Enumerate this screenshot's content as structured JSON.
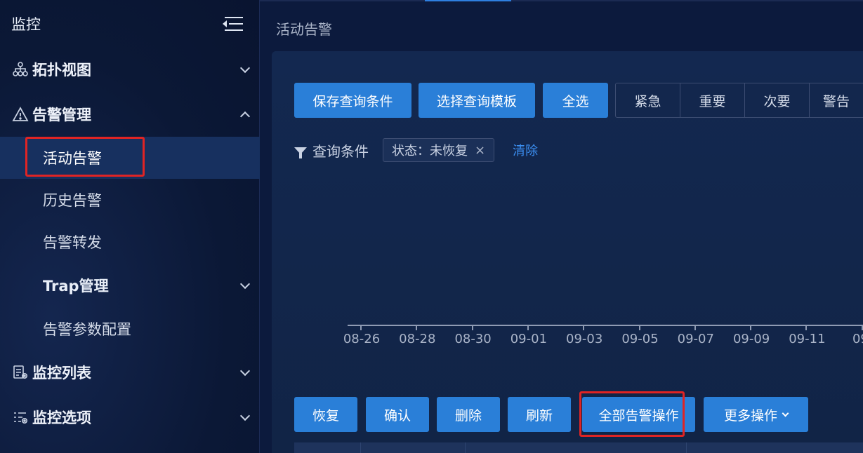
{
  "sidebar": {
    "title": "监控",
    "groups": [
      {
        "label": "拓扑视图",
        "icon": "topology-icon",
        "expanded": false
      },
      {
        "label": "告警管理",
        "icon": "warning-icon",
        "expanded": true
      },
      {
        "label": "监控列表",
        "icon": "monitor-list-icon",
        "expanded": false
      },
      {
        "label": "监控选项",
        "icon": "monitor-options-icon",
        "expanded": false
      }
    ],
    "alarm_items": [
      {
        "label": "活动告警",
        "active": true
      },
      {
        "label": "历史告警"
      },
      {
        "label": "告警转发"
      },
      {
        "label": "Trap管理"
      },
      {
        "label": "告警参数配置"
      }
    ]
  },
  "main": {
    "breadcrumb": "活动告警",
    "toolbar": {
      "save_query": "保存查询条件",
      "select_template": "选择查询模板",
      "select_all": "全选",
      "severity": [
        "紧急",
        "重要",
        "次要",
        "警告"
      ]
    },
    "filter": {
      "label": "查询条件",
      "tag": "状态：未恢复",
      "tag_close": "×",
      "clear": "清除"
    },
    "timeline_ticks": [
      "08-26",
      "08-28",
      "08-30",
      "09-01",
      "09-03",
      "09-05",
      "09-07",
      "09-09",
      "09-11",
      "09-"
    ],
    "actions": {
      "restore": "恢复",
      "confirm": "确认",
      "delete": "删除",
      "refresh": "刷新",
      "all_alarm_ops": "全部告警操作",
      "more_ops": "更多操作"
    }
  },
  "colors": {
    "accent": "#2a7fd8",
    "highlight": "#e02424",
    "background": "#0c1a3d"
  }
}
